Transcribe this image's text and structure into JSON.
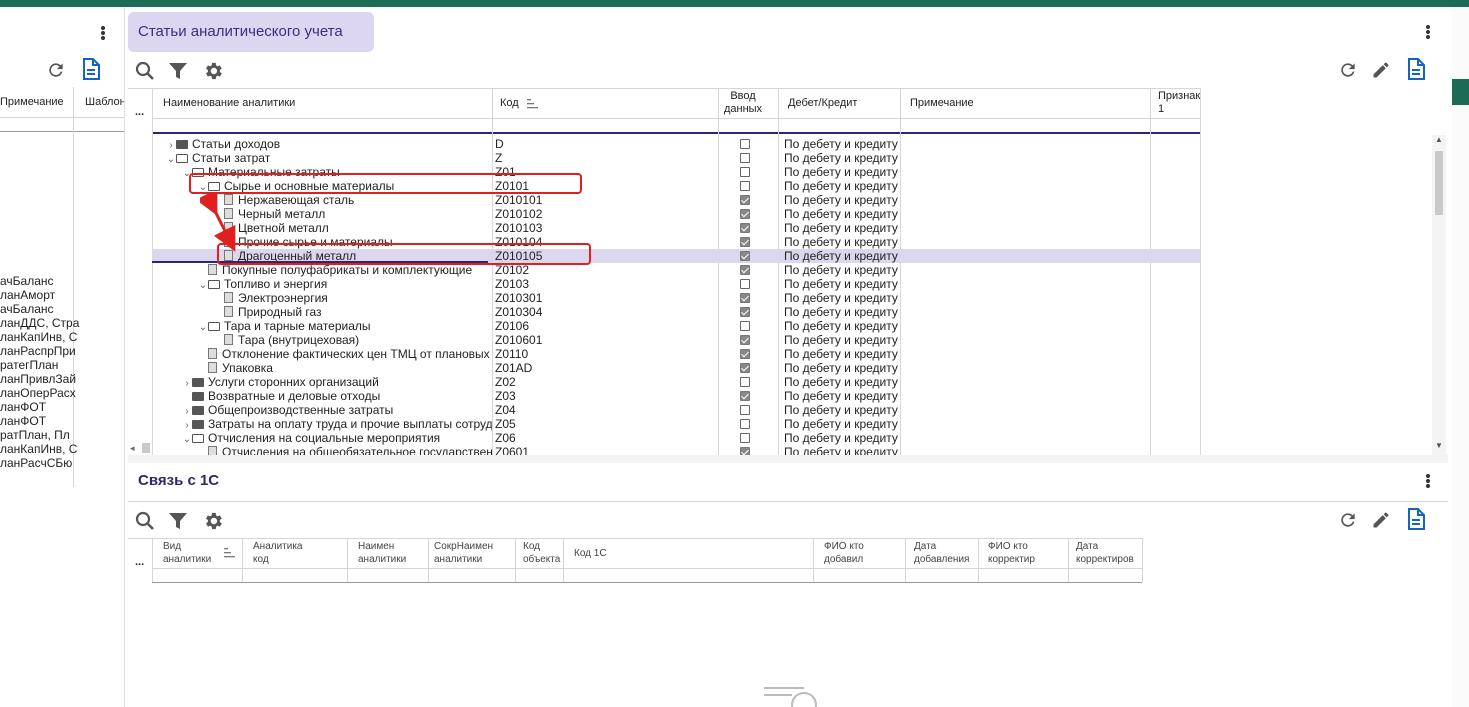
{
  "left_panel": {
    "col_note": "Примечание",
    "col_template": "Шаблон",
    "items": [
      "ачБаланс",
      "ланАморт",
      "ачБаланс",
      "ланДДС, Стра",
      "ланКапИнв, С",
      "ланРаспрПри",
      "ратегПлан",
      "ланПривлЗай",
      "ланОперРасх",
      "ланФОТ",
      "ланФОТ",
      "ратПлан, Пл",
      "ланКапИнв, С",
      "ланРасчСБю"
    ]
  },
  "main": {
    "title": "Статьи аналитического учета",
    "columns": {
      "name": "Наименование аналитики",
      "code": "Код",
      "input_line1": "Ввод",
      "input_line2": "данных",
      "debit_credit": "Дебет/Кредит",
      "note": "Примечание",
      "attr_line1": "Признак",
      "attr_line2": "1"
    },
    "ellipsis": "...",
    "rows": [
      {
        "level": 0,
        "type": "closed",
        "name": "Статьи доходов",
        "code": "D",
        "checked": false,
        "dc": "По дебету и кредиту"
      },
      {
        "level": 0,
        "type": "open",
        "name": "Статьи затрат",
        "code": "Z",
        "checked": false,
        "dc": "По дебету и кредиту"
      },
      {
        "level": 1,
        "type": "open",
        "name": "Материальные затраты",
        "code": "Z01",
        "checked": false,
        "dc": "По дебету и кредиту"
      },
      {
        "level": 2,
        "type": "open",
        "name": "Сырье и основные материалы",
        "code": "Z0101",
        "checked": false,
        "dc": "По дебету и кредиту"
      },
      {
        "level": 3,
        "type": "doc",
        "name": "Нержавеющая сталь",
        "code": "Z010101",
        "checked": true,
        "dc": "По дебету и кредиту"
      },
      {
        "level": 3,
        "type": "doc",
        "name": "Черный металл",
        "code": "Z010102",
        "checked": true,
        "dc": "По дебету и кредиту"
      },
      {
        "level": 3,
        "type": "doc",
        "name": "Цветной металл",
        "code": "Z010103",
        "checked": true,
        "dc": "По дебету и кредиту"
      },
      {
        "level": 3,
        "type": "doc",
        "name": "Прочие сырье и материалы",
        "code": "Z010104",
        "checked": true,
        "dc": "По дебету и кредиту"
      },
      {
        "level": 3,
        "type": "doc",
        "name": "Драгоценный металл",
        "code": "Z010105",
        "checked": true,
        "dc": "По дебету и кредиту",
        "selected": true
      },
      {
        "level": 2,
        "type": "doc",
        "name": "Покупные полуфабрикаты и комплектующие",
        "code": "Z0102",
        "checked": true,
        "dc": "По дебету и кредиту"
      },
      {
        "level": 2,
        "type": "open",
        "name": "Топливо и энергия",
        "code": "Z0103",
        "checked": false,
        "dc": "По дебету и кредиту"
      },
      {
        "level": 3,
        "type": "doc",
        "name": "Электроэнергия",
        "code": "Z010301",
        "checked": true,
        "dc": "По дебету и кредиту"
      },
      {
        "level": 3,
        "type": "doc",
        "name": "Природный газ",
        "code": "Z010304",
        "checked": true,
        "dc": "По дебету и кредиту"
      },
      {
        "level": 2,
        "type": "open",
        "name": "Тара и тарные материалы",
        "code": "Z0106",
        "checked": false,
        "dc": "По дебету и кредиту"
      },
      {
        "level": 3,
        "type": "doc",
        "name": "Тара (внутрицеховая)",
        "code": "Z010601",
        "checked": true,
        "dc": "По дебету и кредиту"
      },
      {
        "level": 2,
        "type": "doc",
        "name": "Отклонение фактических цен ТМЦ от плановых",
        "code": "Z0110",
        "checked": true,
        "dc": "По дебету и кредиту"
      },
      {
        "level": 2,
        "type": "doc",
        "name": "Упаковка",
        "code": "Z01AD",
        "checked": true,
        "dc": "По дебету и кредиту"
      },
      {
        "level": 1,
        "type": "closed",
        "name": "Услуги сторонних организаций",
        "code": "Z02",
        "checked": false,
        "dc": "По дебету и кредиту"
      },
      {
        "level": 1,
        "type": "closed",
        "name": "Возвратные и деловые отходы",
        "code": "Z03",
        "checked": true,
        "dc": "По дебету и кредиту",
        "nochev": true
      },
      {
        "level": 1,
        "type": "closed",
        "name": "Общепроизводственные затраты",
        "code": "Z04",
        "checked": false,
        "dc": "По дебету и кредиту"
      },
      {
        "level": 1,
        "type": "closed",
        "name": "Затраты на оплату труда и прочие выплаты сотрудникам",
        "code": "Z05",
        "checked": false,
        "dc": "По дебету и кредиту"
      },
      {
        "level": 1,
        "type": "open",
        "name": "Отчисления на социальные мероприятия",
        "code": "Z06",
        "checked": false,
        "dc": "По дебету и кредиту"
      },
      {
        "level": 2,
        "type": "doc",
        "name": "Отчисления на общеобязательное государственное страхование",
        "code": "Z0601",
        "checked": true,
        "dc": "По дебету и кредиту"
      }
    ]
  },
  "link": {
    "title": "Связь с 1С",
    "ellipsis": "...",
    "columns": {
      "kind_1": "Вид",
      "kind_2": "аналитики",
      "analytic_code_1": "Аналитика",
      "analytic_code_2": "код",
      "name_1": "Наимен",
      "name_2": "аналитики",
      "short_1": "СокрНаимен",
      "short_2": "аналитики",
      "obj_1": "Код",
      "obj_2": "объекта",
      "code1c": "Код 1С",
      "who_add_1": "ФИО кто",
      "who_add_2": "добавил",
      "date_add_1": "Дата",
      "date_add_2": "добавления",
      "who_edit_1": "ФИО кто",
      "who_edit_2": "корректир",
      "date_edit_1": "Дата",
      "date_edit_2": "корректиров"
    }
  },
  "colors": {
    "accent": "#2e2770",
    "selected_row": "#dcd6ee",
    "title_chip": "#dcd6f0",
    "topbar": "#1c6b55",
    "annotation": "#e02020"
  },
  "icons": [
    "search-icon",
    "filter-icon",
    "gear-icon",
    "refresh-icon",
    "pencil-icon",
    "document-icon",
    "kebab-menu-icon",
    "sort-icon"
  ]
}
